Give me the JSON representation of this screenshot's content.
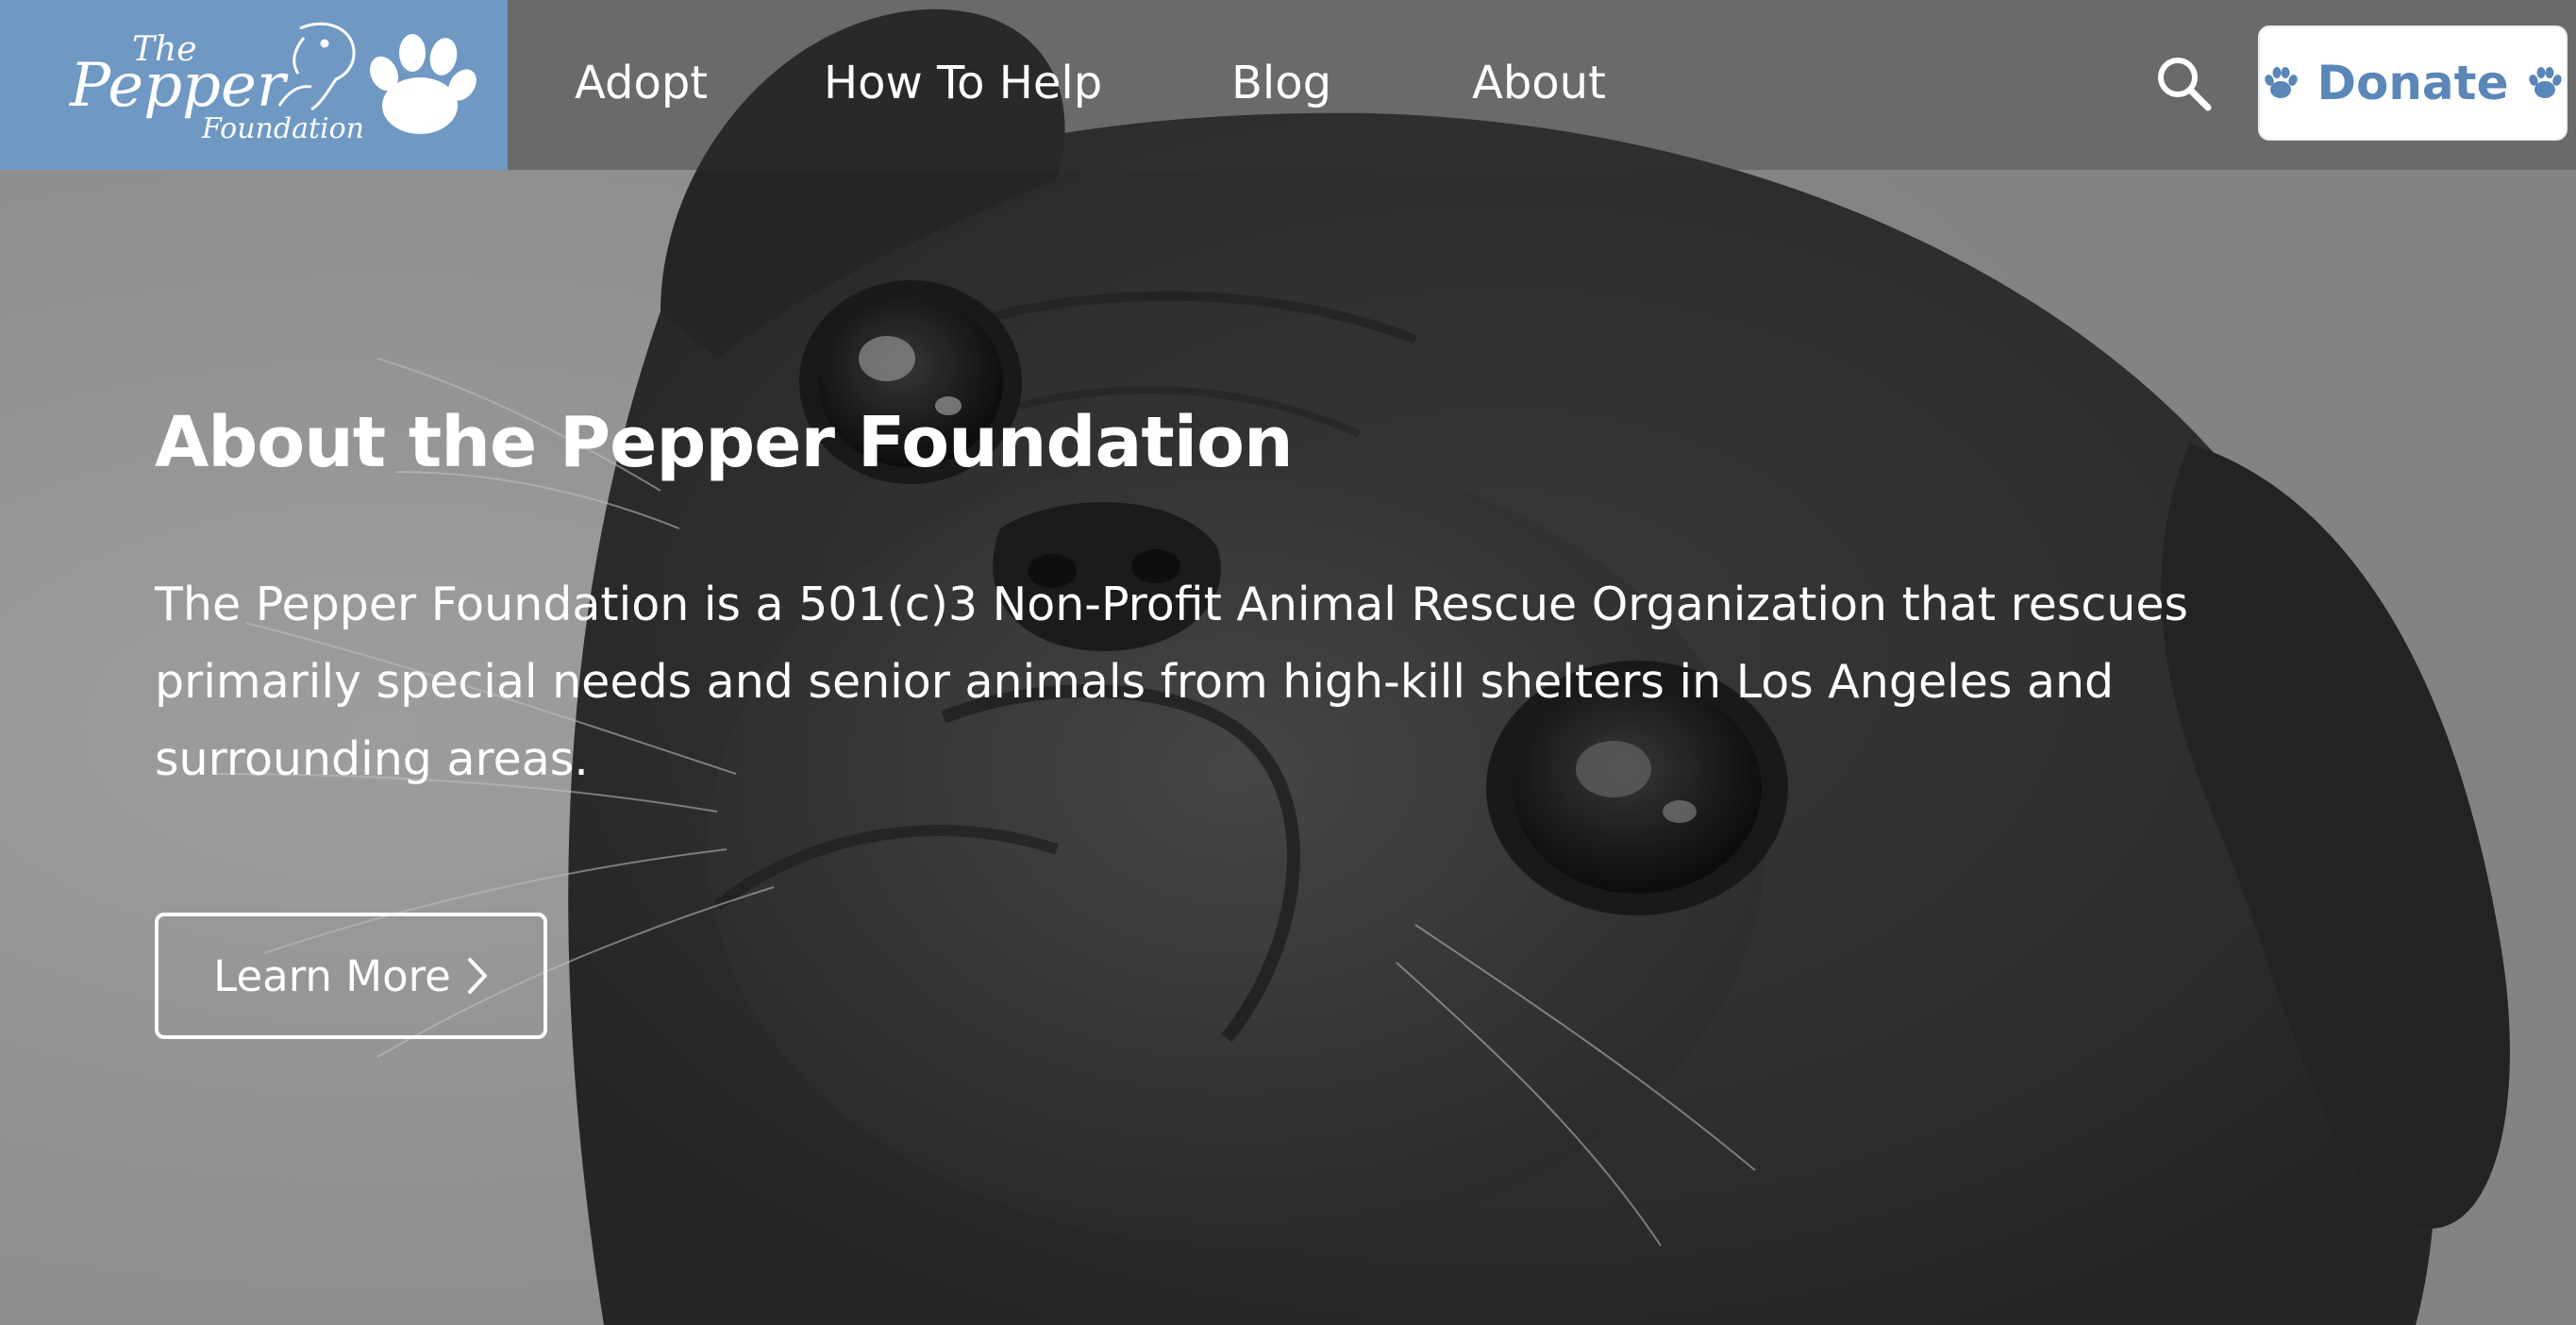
{
  "brand": {
    "logo_line1": "The",
    "logo_line2": "Pepper",
    "logo_line3": "Foundation",
    "logo_bg_color": "#6f98c3"
  },
  "nav": {
    "items": [
      {
        "label": "Adopt"
      },
      {
        "label": "How To Help"
      },
      {
        "label": "Blog"
      },
      {
        "label": "About"
      }
    ]
  },
  "header_actions": {
    "search_icon": "search-icon",
    "donate_label": "Donate",
    "donate_icon": "paw-icon",
    "donate_text_color": "#5b86b8"
  },
  "hero": {
    "title": "About the Pepper Foundation",
    "description": "The Pepper Foundation is a 501(c)3 Non-Profit Animal Rescue Organization that rescues primarily special needs and senior animals from high-kill shelters in Los Angeles and surrounding areas.",
    "cta_label": "Learn More",
    "cta_icon": "chevron-right-icon",
    "background_image": "grayscale photo of black pug looking up"
  }
}
